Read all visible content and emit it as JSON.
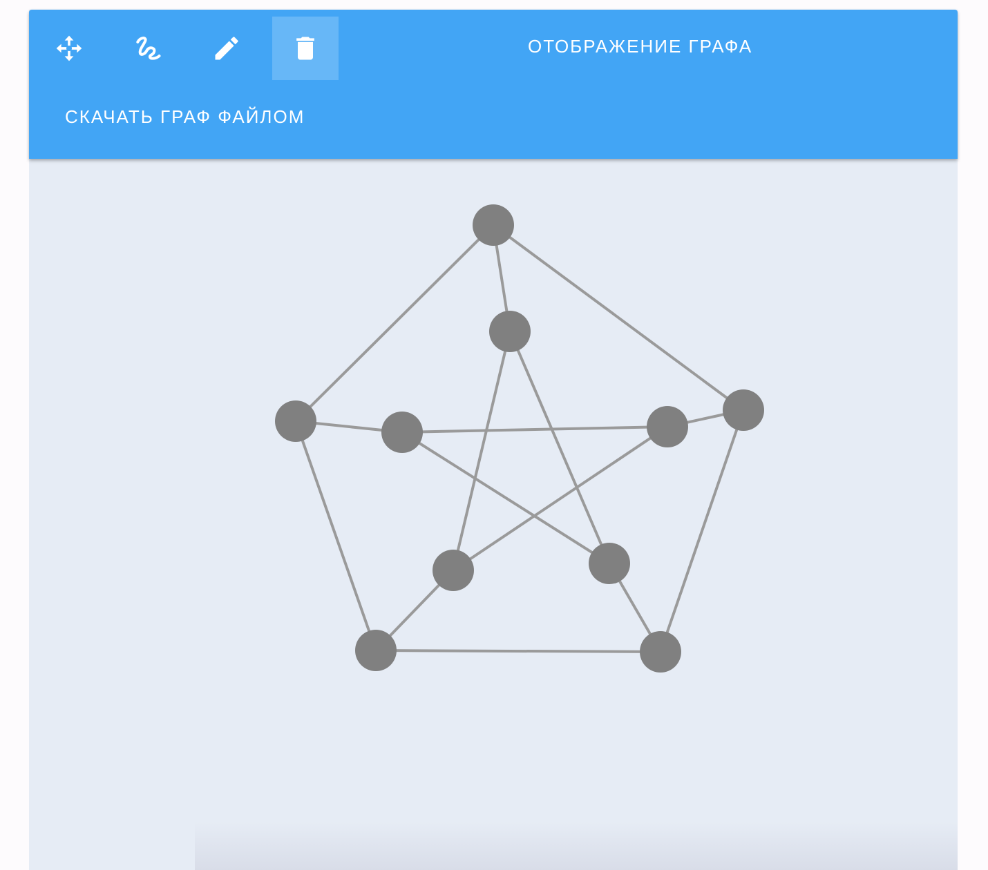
{
  "toolbar": {
    "title": "ОТОБРАЖЕНИЕ ГРАФА",
    "download_label": "СКАЧАТЬ ГРАФ ФАЙЛОМ",
    "tools": [
      {
        "icon": "move-icon",
        "active": false
      },
      {
        "icon": "draw-edge-icon",
        "active": false
      },
      {
        "icon": "pencil-icon",
        "active": false
      },
      {
        "icon": "trash-icon",
        "active": true
      }
    ]
  },
  "colors": {
    "toolbar": "#42a5f5",
    "canvas_background": "#e6ecf5",
    "node_fill": "#808080",
    "edge_stroke": "#9a9a9a"
  },
  "graph": {
    "node_count": 10,
    "edges": [
      [
        0,
        1
      ],
      [
        0,
        4
      ],
      [
        0,
        5
      ],
      [
        1,
        2
      ],
      [
        2,
        3
      ],
      [
        3,
        4
      ],
      [
        5,
        7
      ],
      [
        5,
        8
      ],
      [
        6,
        8
      ],
      [
        6,
        9
      ],
      [
        7,
        9
      ],
      [
        1,
        6
      ],
      [
        2,
        7
      ],
      [
        3,
        8
      ],
      [
        4,
        9
      ]
    ]
  }
}
